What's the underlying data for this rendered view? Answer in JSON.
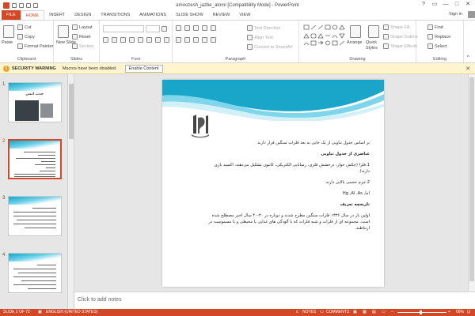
{
  "window": {
    "title": "amoozesh_jazbe_atomi [Compatibility Mode] - PowerPoint",
    "controls": [
      "?",
      "▭",
      "—",
      "□",
      "✕"
    ]
  },
  "tabs": [
    "FILE",
    "HOME",
    "INSERT",
    "DESIGN",
    "TRANSITIONS",
    "ANIMATIONS",
    "SLIDE SHOW",
    "REVIEW",
    "VIEW"
  ],
  "active_tab": "HOME",
  "signin": "Sign in",
  "ribbon": {
    "clipboard": {
      "group_label": "Clipboard",
      "paste": "Paste",
      "cut": "Cut",
      "copy": "Copy",
      "format_painter": "Format Painter"
    },
    "slides": {
      "group_label": "Slides",
      "new_slide": "New Slide",
      "layout": "Layout",
      "reset": "Reset",
      "section": "Section"
    },
    "font": {
      "group_label": "Font"
    },
    "paragraph": {
      "group_label": "Paragraph",
      "text_direction": "Text Direction",
      "align_text": "Align Text",
      "convert_smartart": "Convert to SmartArt"
    },
    "drawing": {
      "group_label": "Drawing",
      "arrange": "Arrange",
      "quick_styles": "Quick Styles",
      "shape_fill": "Shape Fill",
      "shape_outline": "Shape Outline",
      "shape_effects": "Shape Effects"
    },
    "editing": {
      "group_label": "Editing",
      "find": "Find",
      "replace": "Replace",
      "select": "Select"
    }
  },
  "security": {
    "label": "SECURITY WARNING",
    "message": "Macros have been disabled.",
    "button": "Enable Content"
  },
  "thumbnails": [
    {
      "num": "1",
      "title": "جذب اتمی"
    },
    {
      "num": "2"
    },
    {
      "num": "3"
    },
    {
      "num": "4"
    }
  ],
  "slide": {
    "lines": [
      "بر اساس جدول تناوبی از یک جایی به بعد فلزات سنگین قرار دارند",
      "عناصری از جدول تناوبی",
      "1.فلزا (چکش خوار، درخشش فلزی، رسانایی الکتریکی، کاتیون تشکیل می‌دهند، اکسید بازی",
      "دارند).",
      "2.جرم حجمی بالایی دارند.",
      "Hg ,Al ,As ,اما",
      "تاریخچه تعریف",
      "اولین بار در سال ۱۳۳۶ فلزات سنگین مطرح شدند و دوباره در ۳۰-۴۰ سال اخیر مصطلح شده",
      "است. مجموعه ای از فلزات و شبه فلزات که با آلودگی های غذایی یا محیطی و یا مسمومیت در",
      "ارتباطند."
    ]
  },
  "notes_placeholder": "Click to add notes",
  "status": {
    "slide_of": "SLIDE 2 OF 72",
    "language": "ENGLISH (UNITED STATES)",
    "notes": "NOTES",
    "comments": "COMMENTS",
    "zoom": "66%"
  },
  "colors": {
    "accent": "#d24726",
    "wave": "#17a5c8",
    "warning": "#fff4ce"
  }
}
